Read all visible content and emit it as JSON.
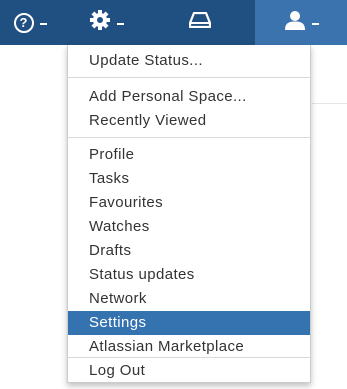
{
  "header": {
    "help_icon_glyph": "?",
    "help_icon": "help-icon",
    "settings_icon": "gear-icon",
    "notifications_icon": "inbox-icon",
    "user_icon": "user-icon",
    "bar_color": "#205081",
    "active_button_color": "#3b73af"
  },
  "menu": {
    "items": [
      {
        "label": "Update Status..."
      },
      {
        "label": "Add Personal Space..."
      },
      {
        "label": "Recently Viewed"
      },
      {
        "label": "Profile"
      },
      {
        "label": "Tasks"
      },
      {
        "label": "Favourites"
      },
      {
        "label": "Watches"
      },
      {
        "label": "Drafts"
      },
      {
        "label": "Status updates"
      },
      {
        "label": "Network"
      },
      {
        "label": "Settings",
        "selected": true
      },
      {
        "label": "Atlassian Marketplace"
      },
      {
        "label": "Log Out"
      }
    ],
    "highlight_color": "#3572b0"
  }
}
